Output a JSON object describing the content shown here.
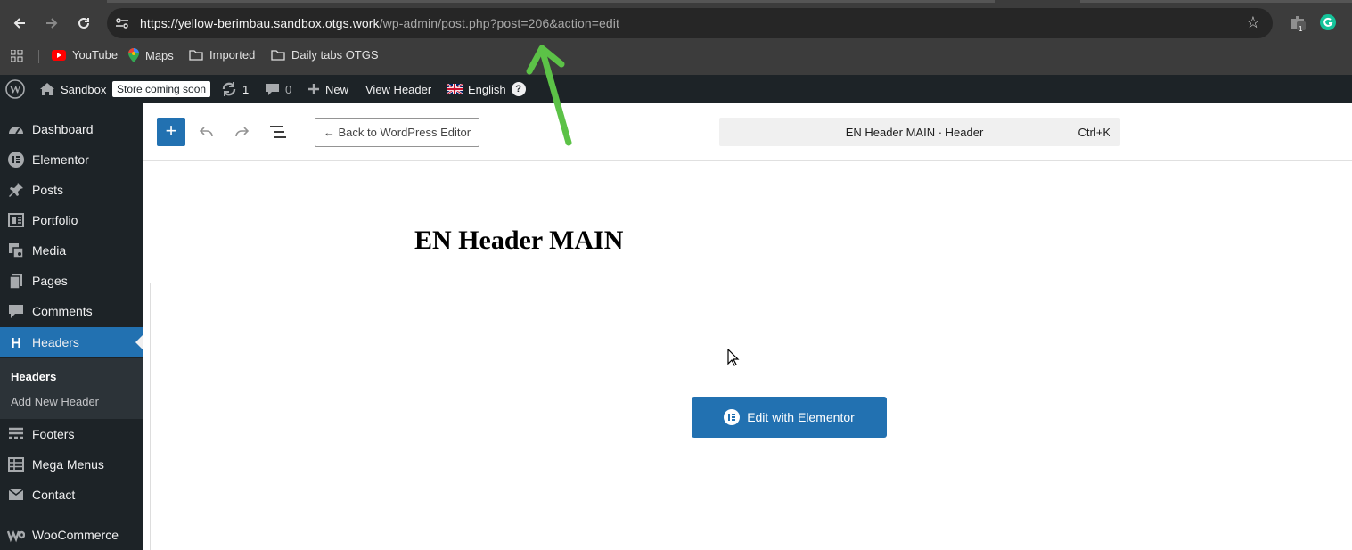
{
  "browser": {
    "url_host": "https://yellow-berimbau.sandbox.otgs.work",
    "url_path": "/wp-admin/post.php?post=206&action=edit",
    "extension_badge": "1",
    "icons": [
      "back-arrow-icon",
      "forward-arrow-icon",
      "reload-icon",
      "site-settings-icon",
      "bookmark-star-icon",
      "extension-icon",
      "grammarly-icon",
      "apps-grid-icon"
    ]
  },
  "bookmarks": [
    {
      "label": "YouTube",
      "icon": "youtube-icon"
    },
    {
      "label": "Maps",
      "icon": "maps-pin-icon"
    },
    {
      "label": "Imported",
      "icon": "folder-icon"
    },
    {
      "label": "Daily tabs OTGS",
      "icon": "folder-icon"
    }
  ],
  "adminbar": {
    "site_name": "Sandbox",
    "store_badge": "Store coming soon",
    "updates_count": "1",
    "comments_count": "0",
    "new_label": "New",
    "view_label": "View Header",
    "language": "English",
    "help": "?"
  },
  "sidebar": {
    "items": [
      {
        "label": "Dashboard",
        "icon": "dashboard-icon"
      },
      {
        "label": "Elementor",
        "icon": "elementor-icon"
      },
      {
        "label": "Posts",
        "icon": "pin-icon"
      },
      {
        "label": "Portfolio",
        "icon": "portfolio-icon"
      },
      {
        "label": "Media",
        "icon": "media-icon"
      },
      {
        "label": "Pages",
        "icon": "pages-icon"
      },
      {
        "label": "Comments",
        "icon": "comment-icon"
      },
      {
        "label": "Headers",
        "icon": "header-h-icon"
      },
      {
        "label": "Footers",
        "icon": "footer-icon"
      },
      {
        "label": "Mega Menus",
        "icon": "table-icon"
      },
      {
        "label": "Contact",
        "icon": "mail-icon"
      },
      {
        "label": "WooCommerce",
        "icon": "woo-icon"
      }
    ],
    "submenu": [
      "Headers",
      "Add New Header"
    ]
  },
  "editor": {
    "inserter": "+",
    "back_button": "← Back to WordPress Editor",
    "command_title": "EN Header MAIN · Header",
    "command_shortcut": "Ctrl+K",
    "post_title": "EN Header MAIN",
    "edit_with_elementor": "Edit with Elementor"
  },
  "colors": {
    "accent": "#2271b1",
    "adminbar": "#1d2327",
    "annotation_arrow": "#5cc247"
  }
}
